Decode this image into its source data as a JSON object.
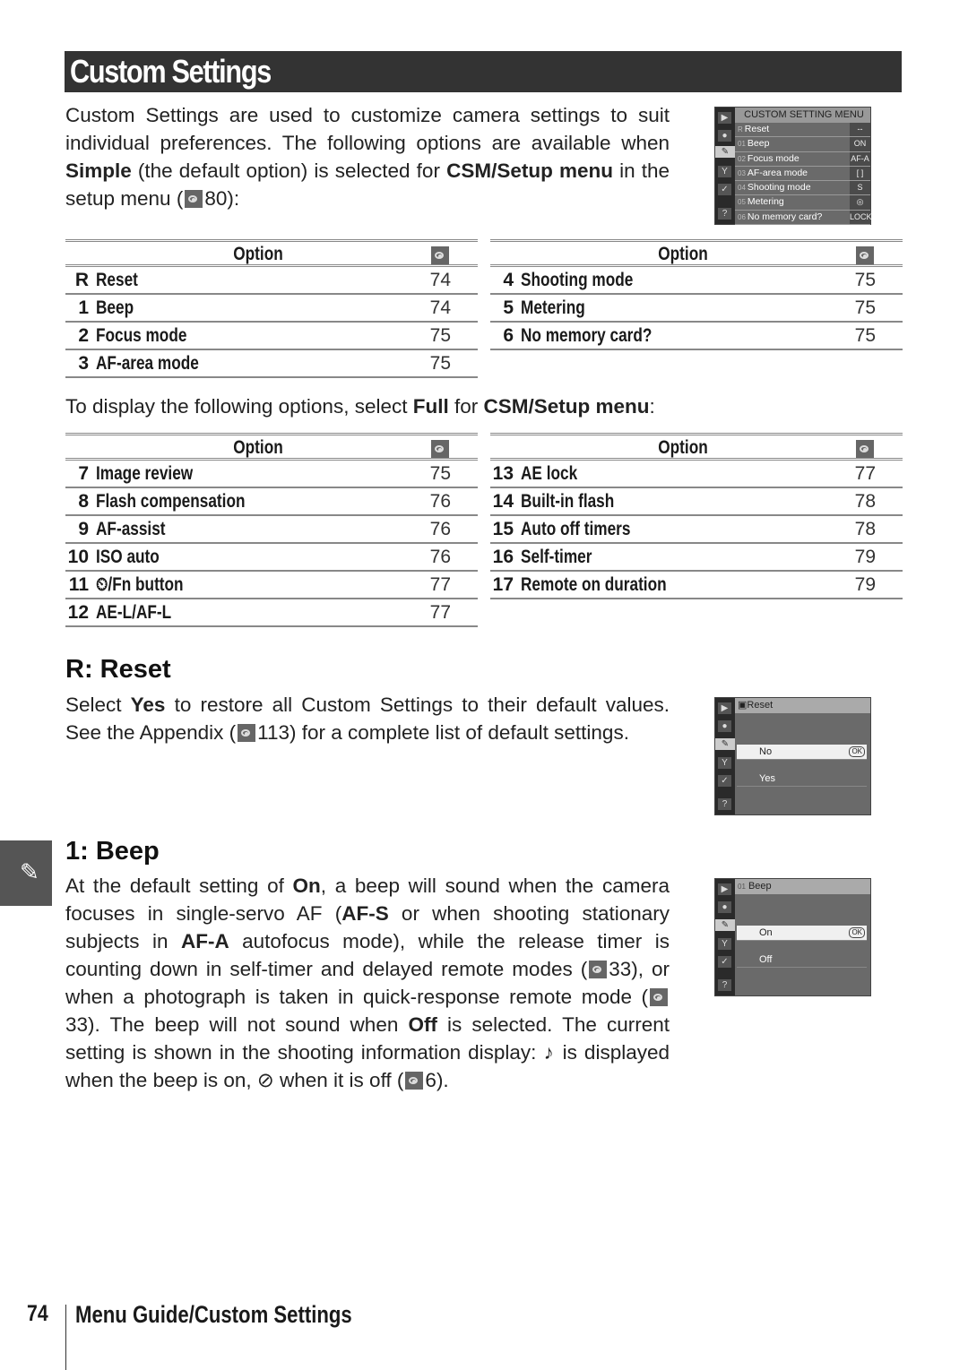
{
  "page_title": "Custom Settings",
  "intro": {
    "t1": "Custom Settings are used to customize camera settings to suit individual preferences. The following options are available when ",
    "b1": "Simple",
    "t2": " (the default option) is selected for ",
    "b2": "CSM/Setup menu",
    "t3": " in the setup menu (",
    "ref": "80",
    "t4": "):"
  },
  "table_header": {
    "option": "Option",
    "page_icon": "reference-icon"
  },
  "simple_tables": [
    [
      {
        "num": "R",
        "name": "Reset",
        "page": "74"
      },
      {
        "num": "1",
        "name": "Beep",
        "page": "74"
      },
      {
        "num": "2",
        "name": "Focus mode",
        "page": "75"
      },
      {
        "num": "3",
        "name": "AF-area mode",
        "page": "75"
      }
    ],
    [
      {
        "num": "4",
        "name": "Shooting mode",
        "page": "75"
      },
      {
        "num": "5",
        "name": "Metering",
        "page": "75"
      },
      {
        "num": "6",
        "name": "No memory card?",
        "page": "75"
      }
    ]
  ],
  "full_intro": {
    "t1": "To display the following options, select ",
    "b1": "Full",
    "t2": " for ",
    "b2": "CSM/Setup menu",
    "t3": ":"
  },
  "full_tables": [
    [
      {
        "num": "7",
        "name": "Image review",
        "page": "75"
      },
      {
        "num": "8",
        "name": "Flash compensation",
        "page": "76"
      },
      {
        "num": "9",
        "name": "AF-assist",
        "page": "76"
      },
      {
        "num": "10",
        "name": "ISO auto",
        "page": "76"
      },
      {
        "num": "11",
        "name": "⏲/Fn button",
        "page": "77"
      },
      {
        "num": "12",
        "name": "AE-L/AF-L",
        "page": "77"
      }
    ],
    [
      {
        "num": "13",
        "name": "AE lock",
        "page": "77"
      },
      {
        "num": "14",
        "name": "Built-in flash",
        "page": "78"
      },
      {
        "num": "15",
        "name": "Auto off timers",
        "page": "78"
      },
      {
        "num": "16",
        "name": "Self-timer",
        "page": "79"
      },
      {
        "num": "17",
        "name": "Remote on duration",
        "page": "79"
      }
    ]
  ],
  "menu_screen": {
    "title": "CUSTOM SETTING MENU",
    "items": [
      {
        "n": "R",
        "label": "Reset",
        "value": "--"
      },
      {
        "n": "01",
        "label": "Beep",
        "value": "ON"
      },
      {
        "n": "02",
        "label": "Focus mode",
        "value": "AF-A"
      },
      {
        "n": "03",
        "label": "AF-area mode",
        "value": "[ ]"
      },
      {
        "n": "04",
        "label": "Shooting mode",
        "value": "S"
      },
      {
        "n": "05",
        "label": "Metering",
        "value": "◎"
      },
      {
        "n": "06",
        "label": "No memory card?",
        "value": "LOCK"
      }
    ]
  },
  "reset": {
    "heading": "R: Reset",
    "t1": "Select ",
    "b1": "Yes",
    "t2": " to restore all Custom Settings to their default values. See the Appendix (",
    "ref": "113",
    "t3": ") for a complete list of default settings.",
    "screen": {
      "title": "Reset",
      "options": [
        "No",
        "Yes"
      ],
      "ok": "OK"
    }
  },
  "beep": {
    "heading": "1: Beep",
    "t1": "At the default setting of ",
    "b1": "On",
    "t2": ", a beep will sound when the camera focuses in single-servo AF (",
    "b2": "AF-S",
    "t3": " or when shooting stationary subjects in ",
    "b3": "AF-A",
    "t4": " autofocus mode), while the release timer is counting down in self-timer and delayed remote modes (",
    "ref1": "33",
    "t5": "), or when a photograph is taken in quick-response remote mode (",
    "ref2": "33",
    "t6": ").  The beep will not sound when ",
    "b4": "Off",
    "t7": " is selected.  The current setting is shown in the shooting information display: ",
    "sym_on": "♪",
    "t8": " is displayed when the beep is on, ",
    "sym_off": "⊘",
    "t9": " when it is off (",
    "ref3": "6",
    "t10": ").",
    "screen": {
      "title": "Beep",
      "num": "01",
      "options": [
        "On",
        "Off"
      ],
      "ok": "OK"
    }
  },
  "footer": {
    "page_number": "74",
    "section": "Menu Guide/Custom Settings"
  }
}
